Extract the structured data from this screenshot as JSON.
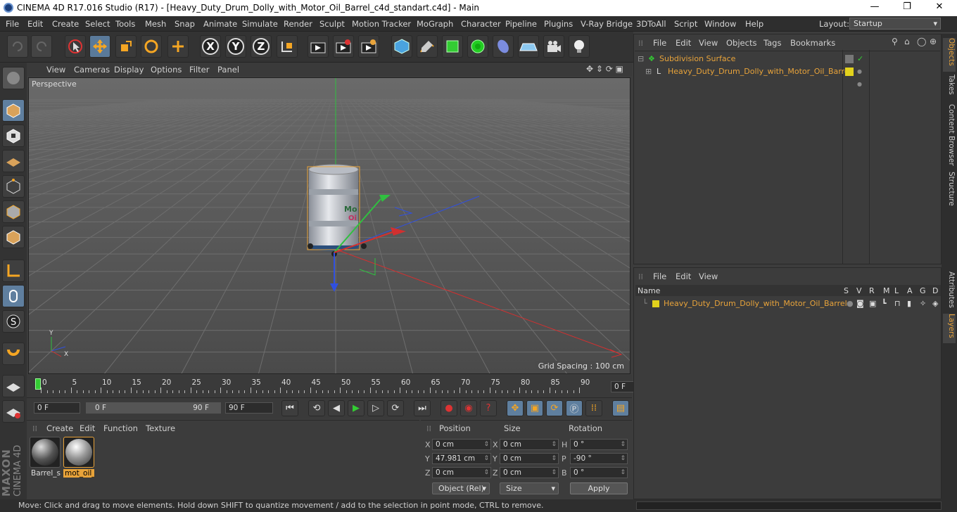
{
  "window": {
    "title": "CINEMA 4D R17.016 Studio (R17) - [Heavy_Duty_Drum_Dolly_with_Motor_Oil_Barrel_c4d_standart.c4d] - Main",
    "minimize": "—",
    "maximize": "❐",
    "close": "✕"
  },
  "menu": [
    "File",
    "Edit",
    "Create",
    "Select",
    "Tools",
    "Mesh",
    "Snap",
    "Animate",
    "Simulate",
    "Render",
    "Sculpt",
    "Motion Tracker",
    "MoGraph",
    "Character",
    "Pipeline",
    "Plugins",
    "V-Ray Bridge",
    "3DToAll",
    "Script",
    "Window",
    "Help"
  ],
  "layout": {
    "label": "Layout:",
    "value": "Startup"
  },
  "toolbar": {
    "x": "X",
    "y": "Y",
    "z": "Z"
  },
  "viewport": {
    "menu": [
      "View",
      "Cameras",
      "Display",
      "Options",
      "Filter",
      "Panel"
    ],
    "label": "Perspective",
    "grid_spacing": "Grid Spacing : 100 cm",
    "axis_x": "X",
    "axis_y": "Y"
  },
  "timeline": {
    "ticks": [
      "0",
      "5",
      "10",
      "15",
      "20",
      "25",
      "30",
      "35",
      "40",
      "45",
      "50",
      "55",
      "60",
      "65",
      "70",
      "75",
      "80",
      "85",
      "90"
    ],
    "current_frame": "0 F"
  },
  "transport": {
    "start": "0 F",
    "range_start": "0 F",
    "range_end": "90 F",
    "end": "90 F"
  },
  "materials": {
    "menu": [
      "Create",
      "Edit",
      "Function",
      "Texture"
    ],
    "items": [
      {
        "label": "Barrel_st"
      },
      {
        "label": "mot_oil_"
      }
    ]
  },
  "coords": {
    "headers": {
      "position": "Position",
      "size": "Size",
      "rotation": "Rotation"
    },
    "rows": [
      {
        "axis": "X",
        "pos": "0 cm",
        "size_axis": "X",
        "size": "0 cm",
        "rot_axis": "H",
        "rot": "0 °"
      },
      {
        "axis": "Y",
        "pos": "47.981 cm",
        "size_axis": "Y",
        "size": "0 cm",
        "rot_axis": "P",
        "rot": "-90 °"
      },
      {
        "axis": "Z",
        "pos": "0 cm",
        "size_axis": "Z",
        "size": "0 cm",
        "rot_axis": "B",
        "rot": "0 °"
      }
    ],
    "mode": "Object (Rel)",
    "size_mode": "Size",
    "apply": "Apply"
  },
  "status": "Move: Click and drag to move elements. Hold down SHIFT to quantize movement / add to the selection in point mode, CTRL to remove.",
  "objects": {
    "menu": [
      "File",
      "Edit",
      "View",
      "Objects",
      "Tags",
      "Bookmarks"
    ],
    "items": [
      {
        "name": "Subdivision Surface"
      },
      {
        "name": "Heavy_Duty_Drum_Dolly_with_Motor_Oil_Barrel"
      }
    ]
  },
  "layers": {
    "menu": [
      "File",
      "Edit",
      "View"
    ],
    "columns": {
      "name": "Name",
      "flags": [
        "S",
        "V",
        "R",
        "M",
        "L",
        "A",
        "G",
        "D"
      ]
    },
    "items": [
      {
        "name": "Heavy_Duty_Drum_Dolly_with_Motor_Oil_Barrel"
      }
    ]
  },
  "right_tabs": [
    "Objects",
    "Takes",
    "Content Browser",
    "Structure",
    "Attributes",
    "Layers"
  ],
  "branding": {
    "maxon": "MAXON",
    "product": "CINEMA 4D"
  },
  "colors": {
    "accent": "#e8a33a",
    "layer_yellow": "#e2d21c",
    "axis_x": "#d23030",
    "axis_y": "#30c040",
    "axis_z": "#3050e0"
  }
}
